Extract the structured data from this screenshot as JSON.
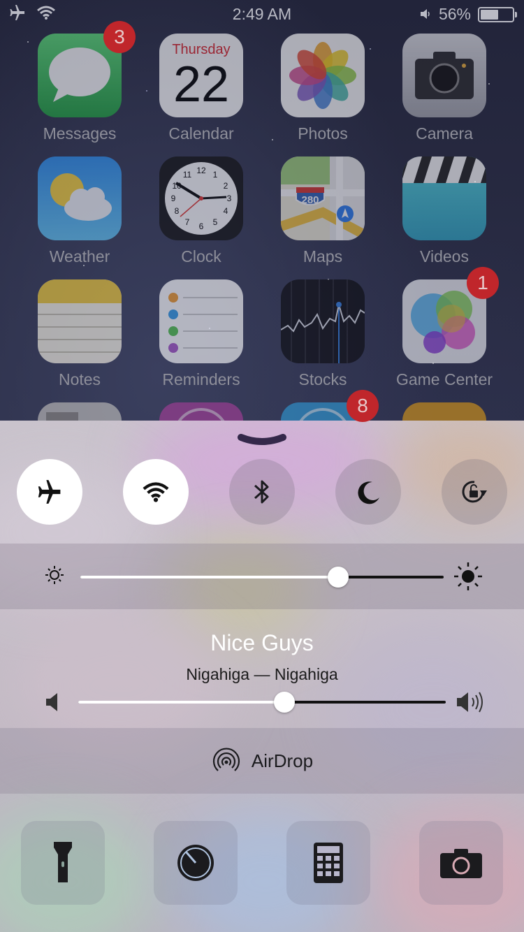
{
  "status_bar": {
    "time": "2:49 AM",
    "battery_percent": "56%",
    "battery_level": 0.56,
    "icons": [
      "airplane-icon",
      "wifi-icon",
      "volume-icon",
      "battery-icon"
    ]
  },
  "home_apps": [
    {
      "label": "Messages",
      "icon": "messages-icon",
      "badge": "3"
    },
    {
      "label": "Calendar",
      "icon": "calendar-icon",
      "weekday": "Thursday",
      "day": "22"
    },
    {
      "label": "Photos",
      "icon": "photos-icon"
    },
    {
      "label": "Camera",
      "icon": "camera-icon"
    },
    {
      "label": "Weather",
      "icon": "weather-icon"
    },
    {
      "label": "Clock",
      "icon": "clock-icon"
    },
    {
      "label": "Maps",
      "icon": "maps-icon",
      "shield": "280"
    },
    {
      "label": "Videos",
      "icon": "videos-icon"
    },
    {
      "label": "Notes",
      "icon": "notes-icon"
    },
    {
      "label": "Reminders",
      "icon": "reminders-icon"
    },
    {
      "label": "Stocks",
      "icon": "stocks-icon"
    },
    {
      "label": "Game Center",
      "icon": "game-center-icon",
      "badge": "1"
    }
  ],
  "partial_row_badge": "8",
  "control_center": {
    "toggles": [
      {
        "name": "airplane-mode",
        "icon": "airplane-icon",
        "on": true
      },
      {
        "name": "wifi",
        "icon": "wifi-icon",
        "on": true
      },
      {
        "name": "bluetooth",
        "icon": "bluetooth-icon",
        "on": false
      },
      {
        "name": "do-not-disturb",
        "icon": "moon-icon",
        "on": false
      },
      {
        "name": "rotation-lock",
        "icon": "rotation-lock-icon",
        "on": false
      }
    ],
    "brightness_level": 0.71,
    "now_playing": {
      "title": "Nice Guys",
      "artist_line": "Nigahiga — Nigahiga"
    },
    "volume_level": 0.56,
    "airdrop_label": "AirDrop",
    "shortcuts": [
      {
        "name": "flashlight",
        "icon": "flashlight-icon"
      },
      {
        "name": "timer",
        "icon": "timer-icon"
      },
      {
        "name": "calculator",
        "icon": "calculator-icon"
      },
      {
        "name": "camera",
        "icon": "camera-icon"
      }
    ],
    "colors": {
      "accent": "#ffffff",
      "badge_red": "#c0262b"
    }
  }
}
